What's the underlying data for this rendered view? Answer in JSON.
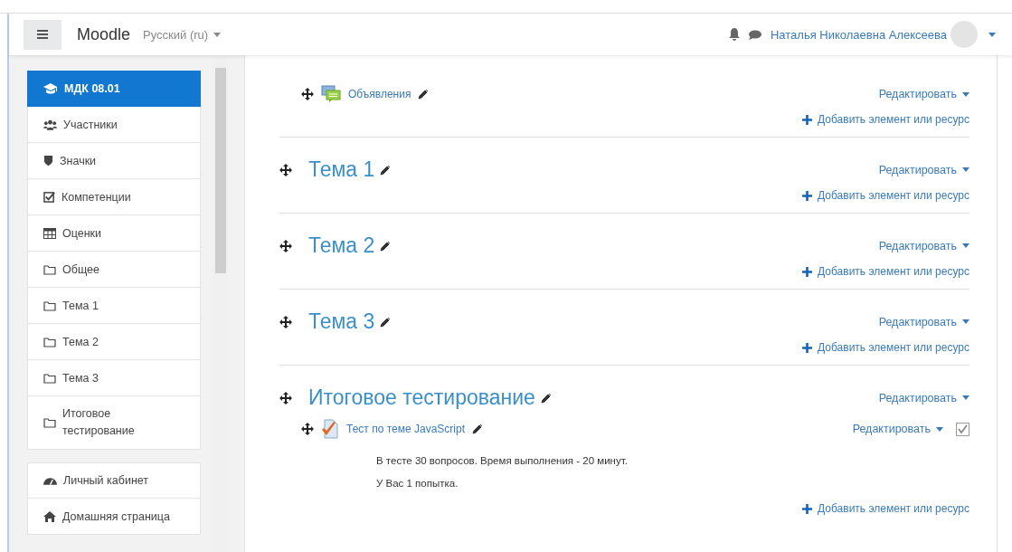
{
  "header": {
    "brand": "Moodle",
    "language": "Русский (ru)",
    "user_name": "Наталья Николаевна Алексеева"
  },
  "sidebar": {
    "groups": [
      {
        "items": [
          {
            "label": "МДК 08.01",
            "kind": "course",
            "selected": true
          },
          {
            "label": "Участники",
            "kind": "participants",
            "selected": false
          },
          {
            "label": "Значки",
            "kind": "badges",
            "selected": false
          },
          {
            "label": "Компетенции",
            "kind": "competencies",
            "selected": false
          },
          {
            "label": "Оценки",
            "kind": "grades",
            "selected": false
          },
          {
            "label": "Общее",
            "kind": "section",
            "selected": false
          },
          {
            "label": "Тема 1",
            "kind": "section",
            "selected": false
          },
          {
            "label": "Тема 2",
            "kind": "section",
            "selected": false
          },
          {
            "label": "Тема 3",
            "kind": "section",
            "selected": false
          },
          {
            "label": "Итоговое тестирование",
            "kind": "section",
            "selected": false
          }
        ]
      },
      {
        "items": [
          {
            "label": "Личный кабинет",
            "kind": "dashboard",
            "selected": false
          },
          {
            "label": "Домашняя страница",
            "kind": "home",
            "selected": false
          }
        ]
      }
    ]
  },
  "sections": [
    {
      "activities": [
        {
          "name": "Объявления",
          "kind": "forum",
          "edit_label": "Редактировать"
        }
      ],
      "add_label": "Добавить элемент или ресурс"
    },
    {
      "title": "Тема 1",
      "edit_label": "Редактировать",
      "add_label": "Добавить элемент или ресурс"
    },
    {
      "title": "Тема 2",
      "edit_label": "Редактировать",
      "add_label": "Добавить элемент или ресурс"
    },
    {
      "title": "Тема 3",
      "edit_label": "Редактировать",
      "add_label": "Добавить элемент или ресурс"
    },
    {
      "title": "Итоговое тестирование",
      "edit_label": "Редактировать",
      "activities": [
        {
          "name": "Тест по теме JavaScript",
          "kind": "quiz",
          "edit_label": "Редактировать",
          "checked": true,
          "description": [
            "В тесте 30 вопросов. Время выполнения - 20 минут.",
            "У Вас 1 попытка."
          ]
        }
      ],
      "add_label": "Добавить элемент или ресурс"
    }
  ]
}
